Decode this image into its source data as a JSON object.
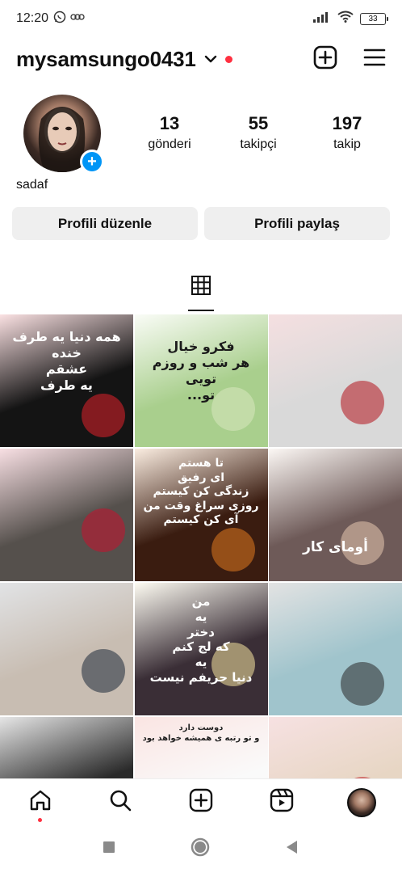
{
  "status": {
    "time": "12:20",
    "battery": "33"
  },
  "header": {
    "username": "mysamsungo0431"
  },
  "profile": {
    "display_name": "sadaf",
    "stats": [
      {
        "value": "13",
        "label": "gönderi"
      },
      {
        "value": "55",
        "label": "takipçi"
      },
      {
        "value": "197",
        "label": "takip"
      }
    ],
    "add_story_symbol": "+"
  },
  "buttons": {
    "edit": "Profili düzenle",
    "share": "Profili paylaş"
  },
  "icons": {
    "status": [
      "whatsapp-icon",
      "voicemail-icon",
      "signal-icon",
      "wifi-icon",
      "battery-icon"
    ],
    "header": [
      "chevron-down-icon",
      "new-post-icon",
      "menu-icon"
    ],
    "tabs": [
      "grid-icon"
    ],
    "bottom_nav": [
      "home-icon",
      "search-icon",
      "create-icon",
      "reels-icon",
      "profile-avatar"
    ],
    "system_nav": [
      "recents-icon",
      "home-button-icon",
      "back-icon"
    ]
  },
  "grid": [
    {
      "caption": "همه دنیا یه طرف\nخنده\nعشقم\nیه طرف",
      "bg": "#141414",
      "fg": "#ffffff",
      "accent": "#e0202a"
    },
    {
      "caption": "فکرو خیال\nهر شب و روزم\nتویی\nتو...",
      "bg": "#a9cf8d",
      "fg": "#1a1a1a",
      "accent": "#d8e8c0"
    },
    {
      "caption": "",
      "bg": "#d9d9d9",
      "fg": "#111111",
      "accent": "#b3121b"
    },
    {
      "caption": "",
      "bg": "#55504c",
      "fg": "#ffffff",
      "accent": "#c8102e"
    },
    {
      "caption": "تا هستم\nای رفیق\nزندگی کن کیستم\nروزی سراغ وقت من آی کن کیستم",
      "bg": "#3a1c10",
      "fg": "#ffffff",
      "accent": "#e07a1f"
    },
    {
      "caption": "أومای کار",
      "bg": "#6e5a58",
      "fg": "#ffffff",
      "accent": "#e8c8b0"
    },
    {
      "caption": "",
      "bg": "#c8bdb2",
      "fg": "#111111",
      "accent": "#1e2a3a"
    },
    {
      "caption": "من\nیه\nدختر\nکه لج کنم\nیه\nدنیا حریفم نیست",
      "bg": "#3a2e36",
      "fg": "#ffffff",
      "accent": "#f5e6a0"
    },
    {
      "caption": "",
      "bg": "#a0c4cc",
      "fg": "#111111",
      "accent": "#2a2a2a"
    },
    {
      "caption": "",
      "bg": "#2a2a2a",
      "fg": "#ffffff",
      "accent": "#444444"
    },
    {
      "caption": "دوست دارد\nو تو رتبه ی همیشه خواهد بود",
      "bg": "#fafafa",
      "fg": "#222222",
      "accent": "#d63a2a"
    },
    {
      "caption": "",
      "bg": "#e7d6c4",
      "fg": "#111111",
      "accent": "#c01f25"
    }
  ]
}
